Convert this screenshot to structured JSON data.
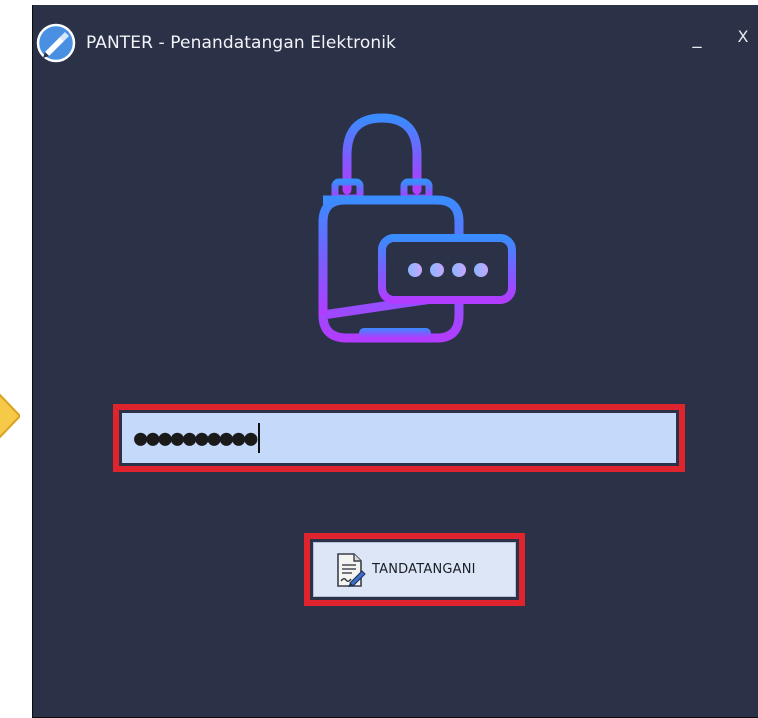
{
  "window": {
    "title": "PANTER - Penandatangan Elektronik",
    "minimize_label": "_",
    "close_label": "X"
  },
  "password_field": {
    "masked_value": "●●●●●●●●●●",
    "length": 10
  },
  "sign_button": {
    "label": "TANDATANGANI"
  },
  "colors": {
    "window_bg": "#2b3248",
    "input_bg": "#c5d9fb",
    "highlight_border": "#e0242e",
    "lock_gradient_top": "#3a8cff",
    "lock_gradient_bottom": "#b23cff",
    "arrow_fill": "#f7c948"
  },
  "icons": {
    "app": "pen-nib-icon",
    "lock": "padlock-password-icon",
    "sign": "sign-document-icon",
    "pointer": "arrow-pointer-icon"
  }
}
